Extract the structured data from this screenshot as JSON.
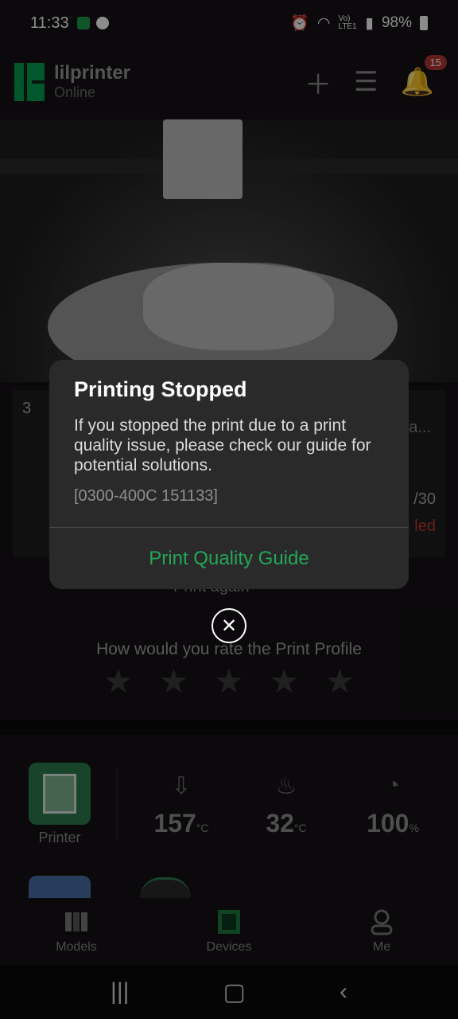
{
  "status_bar": {
    "time": "11:33",
    "network_label": "Vo) LTE1",
    "battery": "98%"
  },
  "header": {
    "printer_name": "lilprinter",
    "printer_status": "Online",
    "notification_count": "15"
  },
  "print_card": {
    "index": "3",
    "name_truncated": "a...",
    "layer_progress": "/30",
    "status_partial": "led",
    "print_again_label": "Print again"
  },
  "rating": {
    "prompt": "How would you rate the Print Profile",
    "stars": 5
  },
  "sensors": {
    "printer_label": "Printer",
    "nozzle_temp": "157",
    "nozzle_unit": "°C",
    "bed_temp": "32",
    "bed_unit": "°C",
    "fan_speed": "100",
    "fan_unit": "%"
  },
  "bottom_nav": {
    "items": [
      {
        "label": "Models"
      },
      {
        "label": "Devices"
      },
      {
        "label": "Me"
      }
    ]
  },
  "dialog": {
    "title": "Printing Stopped",
    "body": "If you stopped the print due to a print quality issue, please check our guide for potential solutions.",
    "error_code": "[0300-400C 151133]",
    "action_label": "Print Quality Guide"
  },
  "colors": {
    "accent_green": "#23a658",
    "badge_red": "#b53636",
    "dialog_bg": "#2b2a2b"
  }
}
